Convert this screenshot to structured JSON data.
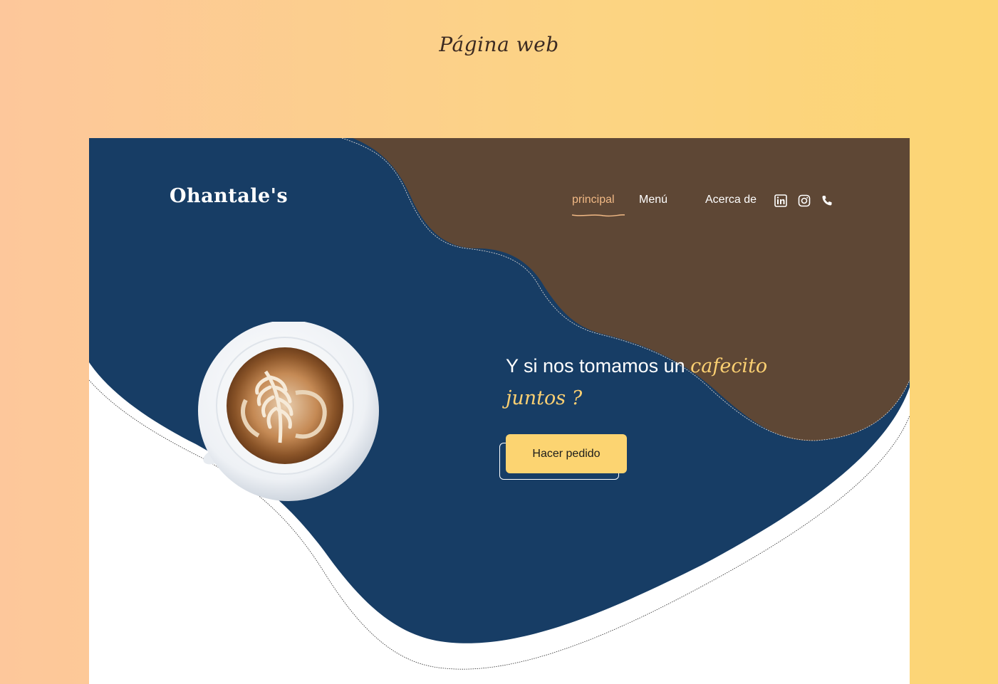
{
  "page": {
    "heading": "Página web"
  },
  "site": {
    "logo": "Ohantale's",
    "nav": [
      {
        "label": "principal",
        "active": true
      },
      {
        "label": "Menú",
        "active": false
      },
      {
        "label": "Acerca de",
        "active": false
      }
    ],
    "social_icons": [
      "linkedin-icon",
      "instagram-icon",
      "phone-icon"
    ]
  },
  "hero": {
    "headline_plain": "Y si nos tomamos un ",
    "headline_script_1": "cafecito",
    "headline_script_2": "juntos ?",
    "button_label": "Hacer pedido",
    "image": "latte-art-coffee-cup"
  },
  "colors": {
    "navy": "#173d65",
    "brown": "#5e4735",
    "accent_yellow": "#fcd471",
    "accent_peach": "#f1b985",
    "white": "#ffffff"
  }
}
